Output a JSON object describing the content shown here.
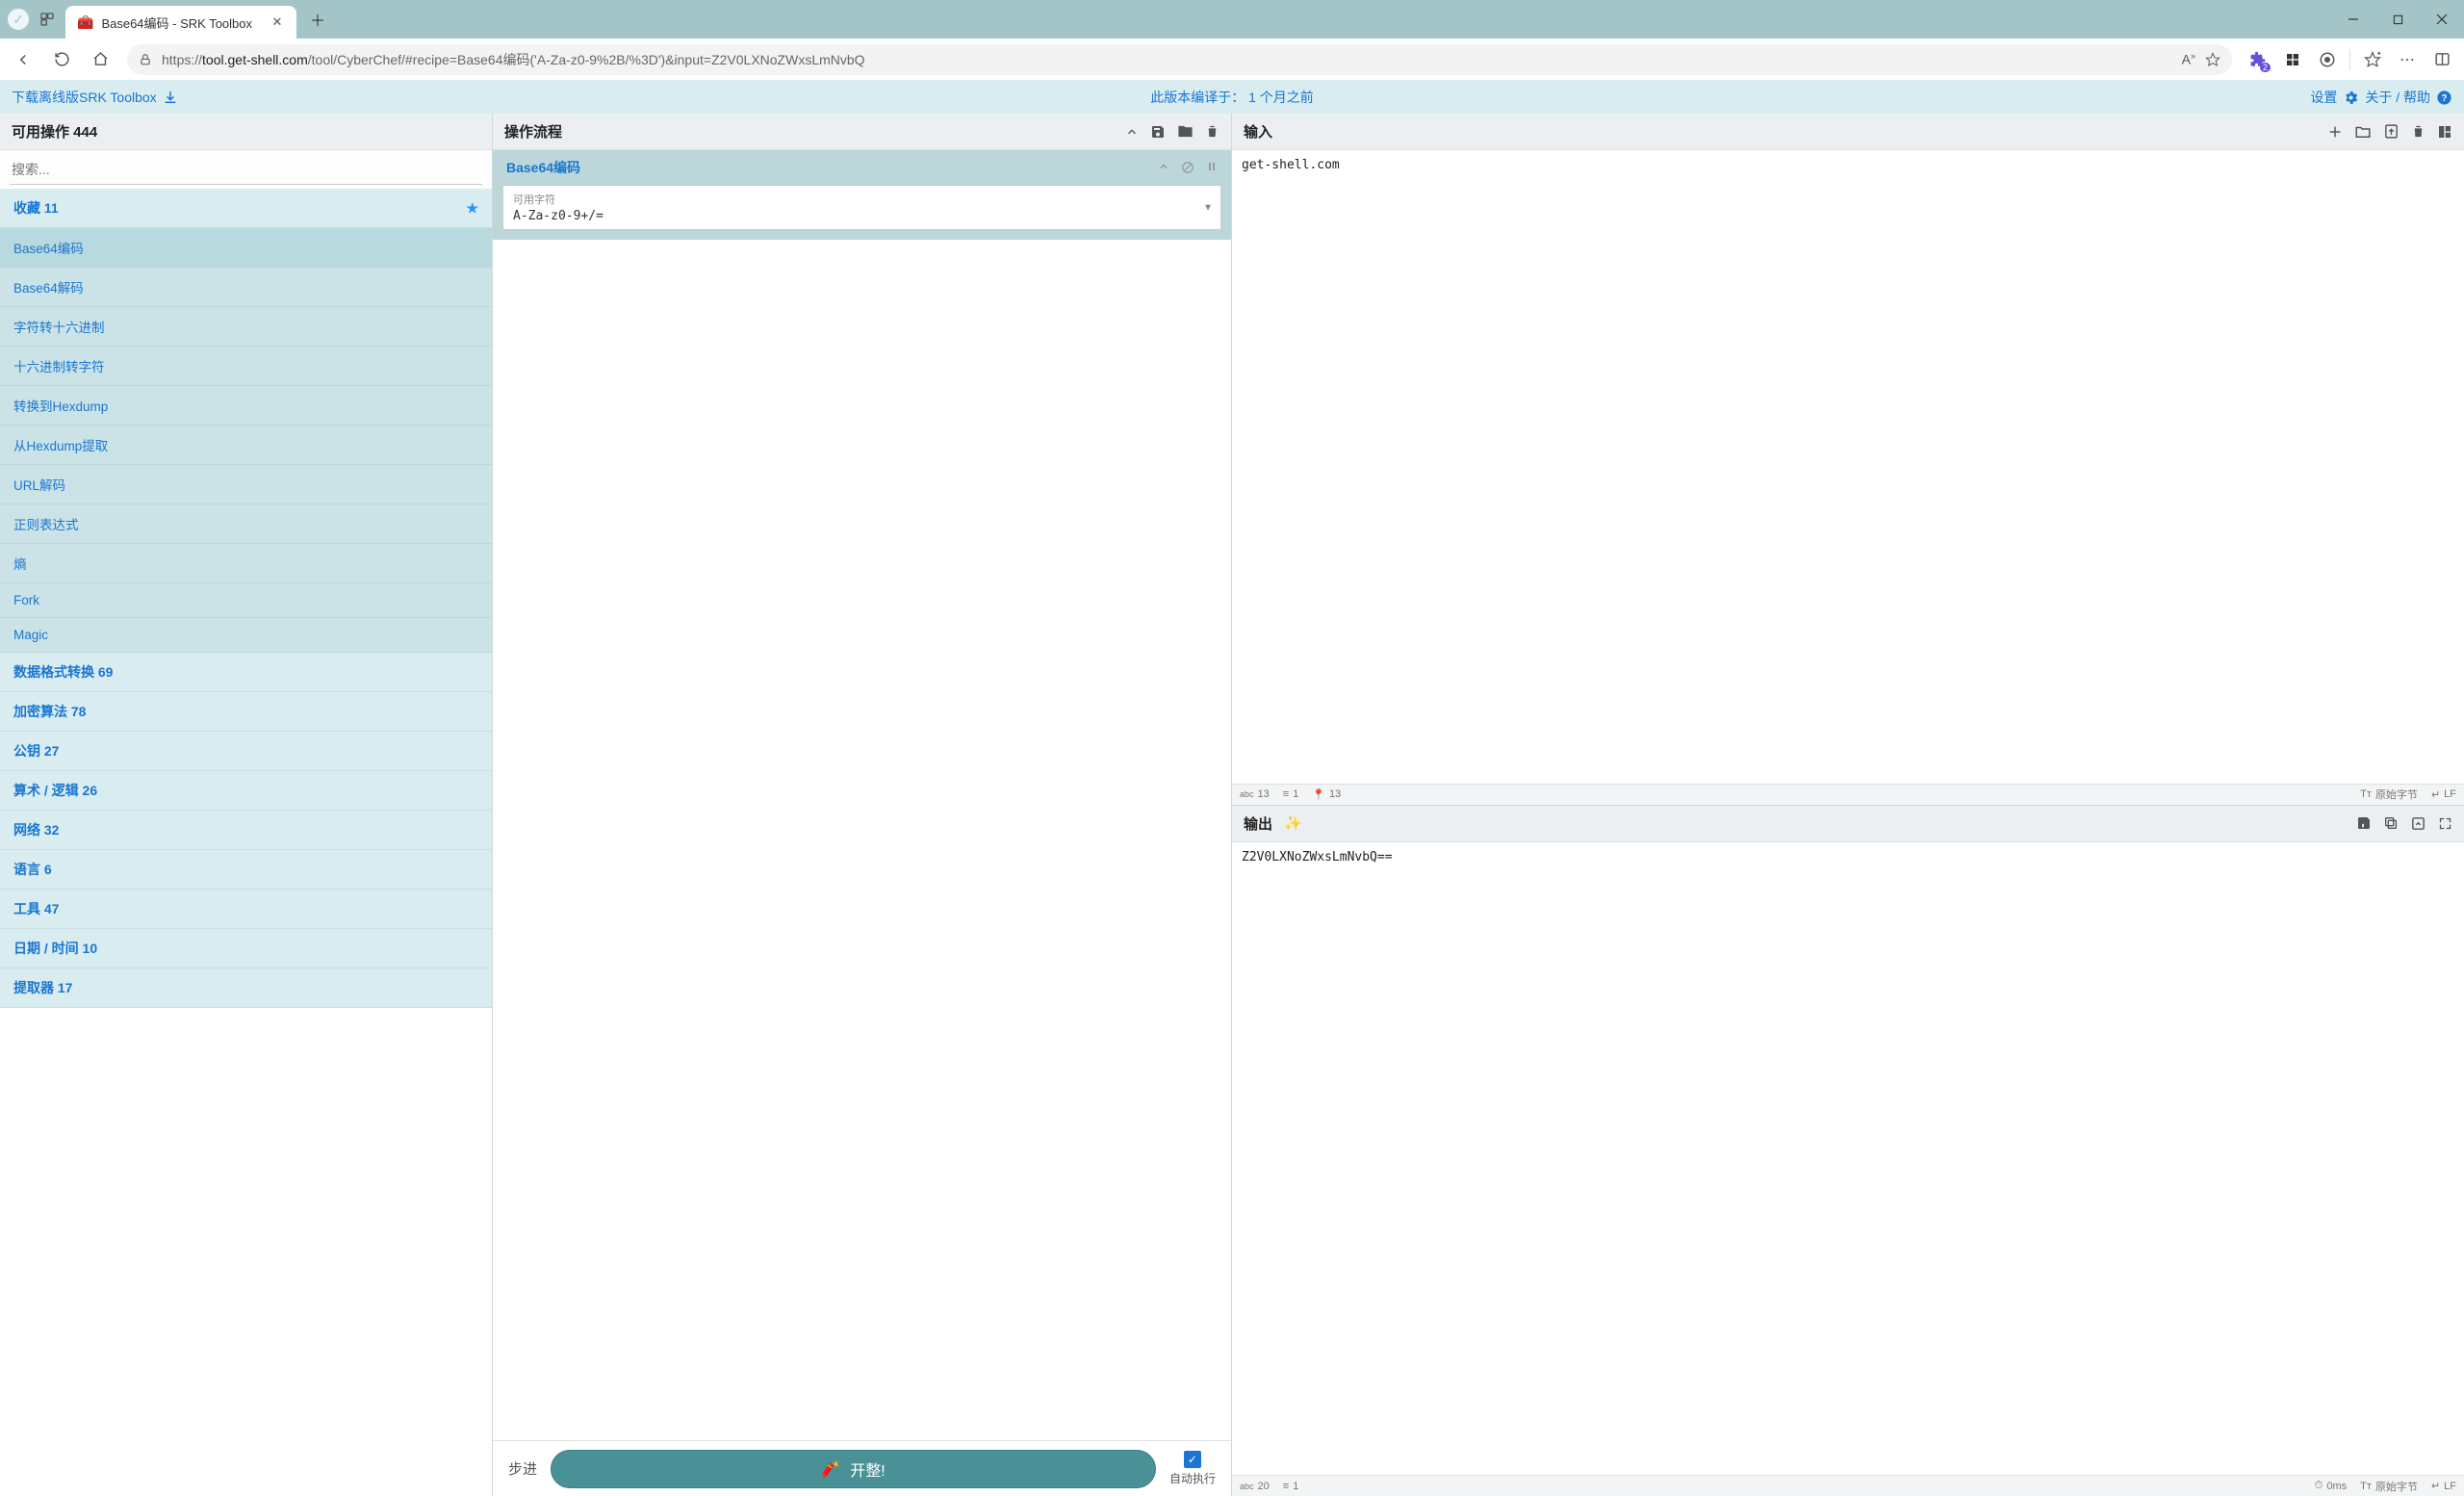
{
  "window": {
    "tab_title": "Base64编码 - SRK Toolbox",
    "url_proto_host": "tool.get-shell.com",
    "url_path": "/tool/CyberChef/#recipe=Base64编码('A-Za-z0-9%2B/%3D')&input=Z2V0LXNoZWxsLmNvbQ"
  },
  "banner": {
    "download": "下载离线版SRK Toolbox",
    "compiled_label": "此版本编译于：",
    "compiled_time": "1 个月之前",
    "settings": "设置",
    "about": "关于 / 帮助"
  },
  "operations": {
    "title": "可用操作 444",
    "search_placeholder": "搜索...",
    "favourites_label": "收藏 11",
    "fav_items": [
      "Base64编码",
      "Base64解码",
      "字符转十六进制",
      "十六进制转字符",
      "转换到Hexdump",
      "从Hexdump提取",
      "URL解码",
      "正则表达式",
      "熵",
      "Fork",
      "Magic"
    ],
    "categories": [
      "数据格式转换 69",
      "加密算法 78",
      "公钥 27",
      "算术 / 逻辑 26",
      "网络 32",
      "语言 6",
      "工具 47",
      "日期 / 时间 10",
      "提取器 17"
    ]
  },
  "recipe": {
    "title": "操作流程",
    "active_op": "Base64编码",
    "arg_label": "可用字符",
    "arg_value": "A-Za-z0-9+/=",
    "step_label": "步进",
    "bake_label": "开整!",
    "autobake_label": "自动执行"
  },
  "input": {
    "title": "输入",
    "text": "get-shell.com",
    "status_abc": "13",
    "status_lines": "1",
    "status_sel": "13",
    "enc_label": "原始字节",
    "eol_label": "LF"
  },
  "output": {
    "title": "输出",
    "text": "Z2V0LXNoZWxsLmNvbQ==",
    "status_abc": "20",
    "status_lines": "1",
    "time": "0ms",
    "enc_label": "原始字节",
    "eol_label": "LF"
  }
}
